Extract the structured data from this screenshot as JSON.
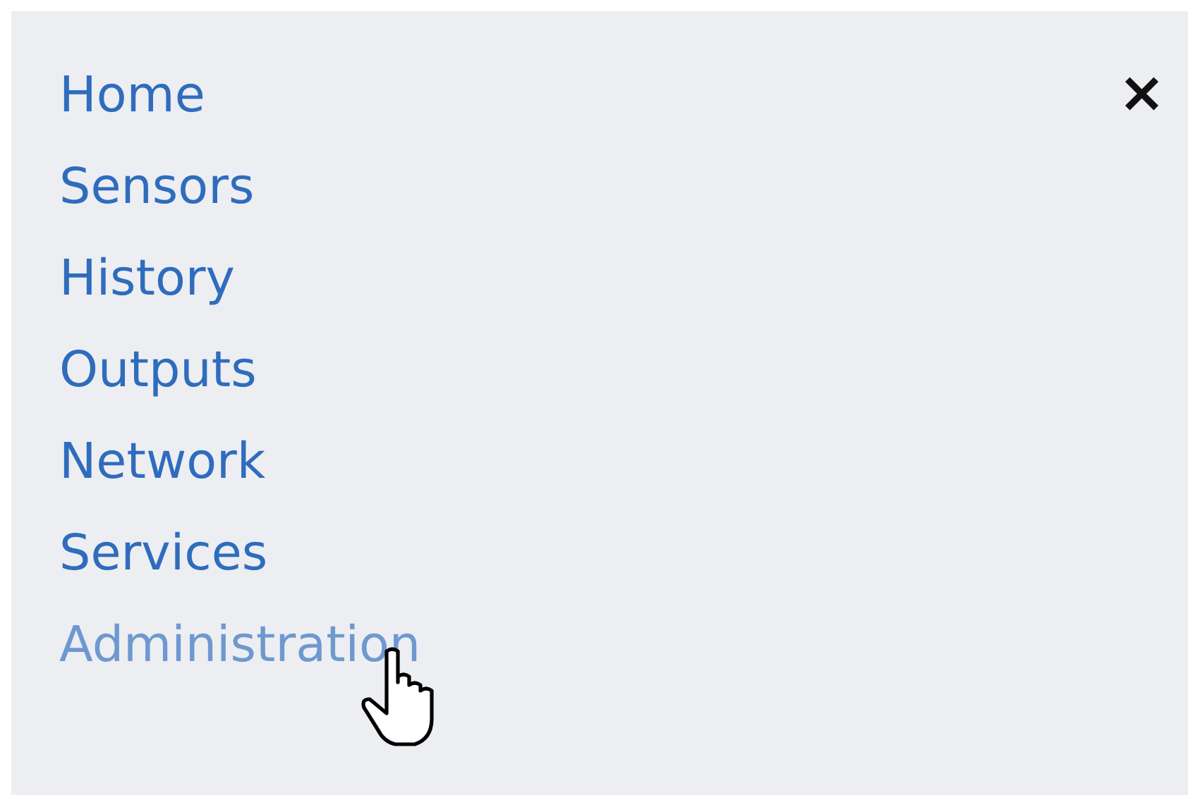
{
  "menu": {
    "close": "×",
    "items": [
      {
        "label": "Home",
        "hovered": false
      },
      {
        "label": "Sensors",
        "hovered": false
      },
      {
        "label": "History",
        "hovered": false
      },
      {
        "label": "Outputs",
        "hovered": false
      },
      {
        "label": "Network",
        "hovered": false
      },
      {
        "label": "Services",
        "hovered": false
      },
      {
        "label": "Administration",
        "hovered": true
      }
    ]
  }
}
